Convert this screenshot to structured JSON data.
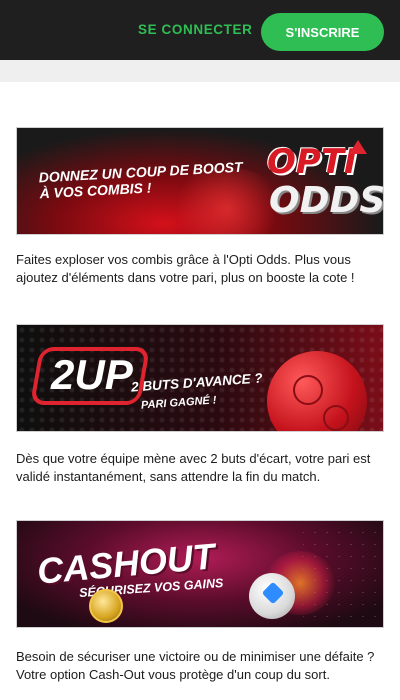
{
  "header": {
    "login_label": "SE CONNECTER",
    "signup_label": "S'INSCRIRE"
  },
  "promos": [
    {
      "banner": {
        "headline_line1": "DONNEZ UN COUP DE BOOST",
        "headline_line2": "À VOS COMBIS !",
        "logo_top": "OPTI",
        "logo_bottom": "ODDS"
      },
      "description": "Faites exploser vos combis grâce à l'Opti Odds. Plus vous ajoutez d'éléments dans votre pari, plus on booste la cote !"
    },
    {
      "banner": {
        "logo": "2UP",
        "headline_line1": "2 BUTS D'AVANCE ?",
        "headline_line2": "PARI GAGNÉ !"
      },
      "description": "Dès que votre équipe mène avec 2 buts d'écart, votre pari est validé instantanément, sans attendre la fin du match."
    },
    {
      "banner": {
        "logo": "CASHOUT",
        "headline": "SÉCURISEZ VOS GAINS"
      },
      "description": "Besoin de sécuriser une victoire ou de minimiser une défaite ? Votre option Cash-Out vous protège d'un coup du sort."
    }
  ],
  "colors": {
    "brand_green": "#2fbe53",
    "topbar": "#1f1f1f",
    "accent_red": "#e0242f"
  }
}
